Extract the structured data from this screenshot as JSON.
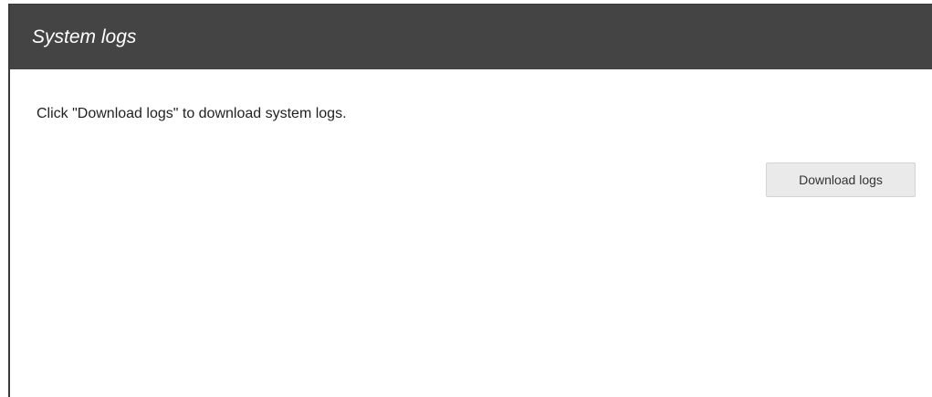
{
  "panel": {
    "title": "System logs",
    "description": "Click \"Download logs\" to download system logs.",
    "download_label": "Download logs"
  },
  "colors": {
    "header_background": "#444444",
    "header_text": "#ffffff",
    "button_background": "#eaeaea"
  }
}
